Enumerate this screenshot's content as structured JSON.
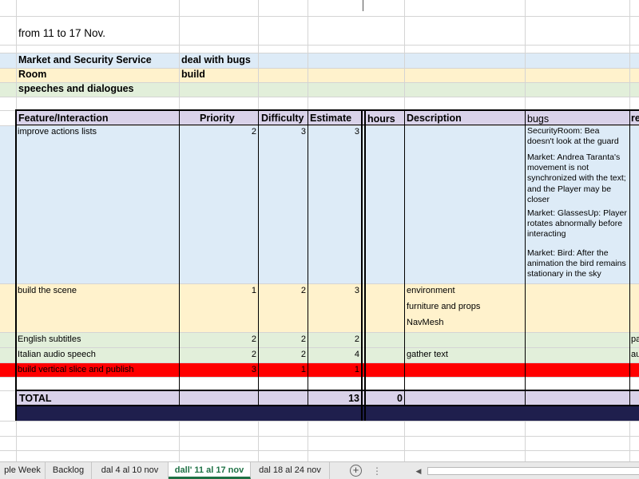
{
  "title": "from 11 to 17 Nov.",
  "legend": [
    {
      "label": "Market and Security Service",
      "value": "deal with bugs"
    },
    {
      "label": "Room",
      "value": "build"
    },
    {
      "label": "speeches and dialogues",
      "value": ""
    }
  ],
  "table": {
    "headers": {
      "feature": "Feature/Interaction",
      "priority": "Priority",
      "difficulty": "Difficulty",
      "estimate": "Estimate",
      "hours": "hours",
      "description": "Description",
      "bugs": "bugs",
      "extra": "re"
    },
    "rows": [
      {
        "feature": "improve actions lists",
        "priority": "2",
        "difficulty": "3",
        "estimate": "3",
        "hours": "",
        "descriptions": [],
        "bugs": [
          "SecurityRoom: Bea doesn't look at the guard",
          "Market: Andrea Taranta's movement is not synchronized with the text; and the Player may be closer",
          "Market: GlassesUp: Player rotates abnormally before interacting",
          "Market: Bird: After the animation the bird remains stationary in the sky"
        ],
        "extra": ""
      },
      {
        "feature": "build the scene",
        "priority": "1",
        "difficulty": "2",
        "estimate": "3",
        "hours": "",
        "descriptions": [
          "environment",
          "furniture and props",
          "NavMesh"
        ],
        "bugs": [],
        "extra": ""
      },
      {
        "feature": "English subtitles",
        "priority": "2",
        "difficulty": "2",
        "estimate": "2",
        "hours": "",
        "descriptions": [
          ""
        ],
        "bugs": [],
        "extra": "pa"
      },
      {
        "feature": "Italian audio speech",
        "priority": "2",
        "difficulty": "2",
        "estimate": "4",
        "hours": "",
        "descriptions": [
          "gather text"
        ],
        "bugs": [],
        "extra": "au"
      },
      {
        "feature": "build vertical slice and publish",
        "priority": "3",
        "difficulty": "1",
        "estimate": "1",
        "hours": "",
        "descriptions": [
          ""
        ],
        "bugs": [],
        "extra": ""
      }
    ],
    "total": {
      "label": "TOTAL",
      "estimate": "13",
      "hours": "0"
    }
  },
  "tabs": [
    {
      "label": "ple Week",
      "active": false
    },
    {
      "label": "Backlog",
      "active": false
    },
    {
      "label": "dal 4 al 10 nov",
      "active": false
    },
    {
      "label": "dall' 11 al 17 nov",
      "active": true
    },
    {
      "label": "dal 18 al 24 nov",
      "active": false
    }
  ],
  "colors": {
    "blue": "#ddebf7",
    "yellow": "#fff2cc",
    "green": "#e2efda",
    "purple": "#d9d2e9",
    "red": "#ff0000",
    "navy": "#1f1f4d",
    "active_tab": "#1e7145"
  }
}
